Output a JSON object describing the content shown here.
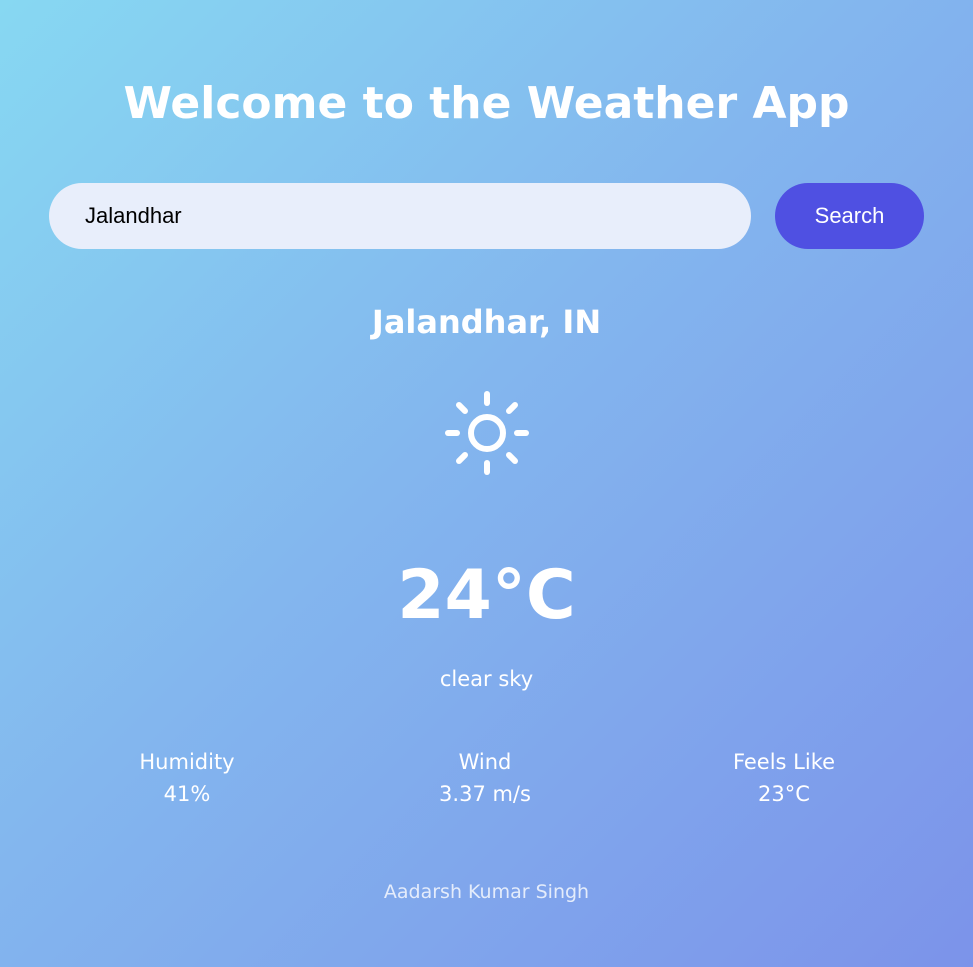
{
  "header": {
    "title": "Welcome to the Weather App"
  },
  "search": {
    "value": "Jalandhar",
    "placeholder": "",
    "button_label": "Search"
  },
  "weather": {
    "location": "Jalandhar, IN",
    "icon": "sun-icon",
    "temperature": "24°C",
    "description": "clear sky",
    "stats": {
      "humidity": {
        "label": "Humidity",
        "value": "41%"
      },
      "wind": {
        "label": "Wind",
        "value": "3.37 m/s"
      },
      "feels_like": {
        "label": "Feels Like",
        "value": "23°C"
      }
    }
  },
  "footer": {
    "author": "Aadarsh Kumar Singh"
  },
  "colors": {
    "button": "#4f50e2",
    "input_background": "#e8eefb",
    "gradient_start": "#87d8f2",
    "gradient_end": "#7c93ea"
  }
}
